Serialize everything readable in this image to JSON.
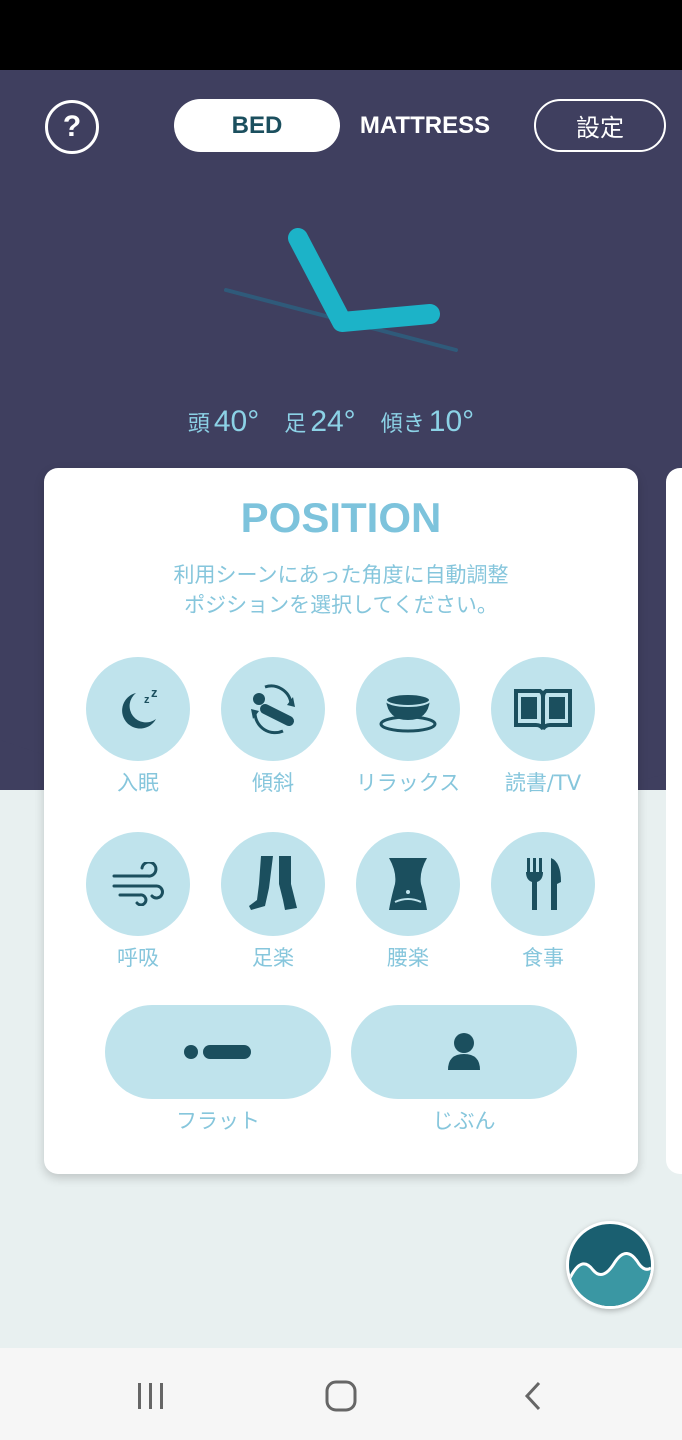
{
  "header": {
    "help_label": "?",
    "tabs": [
      {
        "label": "BED",
        "active": true
      },
      {
        "label": "MATTRESS",
        "active": false
      }
    ],
    "settings_label": "設定"
  },
  "angles": {
    "head_label": "頭",
    "head_value": "40°",
    "foot_label": "足",
    "foot_value": "24°",
    "tilt_label": "傾き",
    "tilt_value": "10°"
  },
  "card": {
    "title": "POSITION",
    "desc_line1": "利用シーンにあった角度に自動調整",
    "desc_line2": "ポジションを選択してください。",
    "positions": [
      {
        "label": "入眠",
        "icon": "sleep-moon-icon"
      },
      {
        "label": "傾斜",
        "icon": "tilt-rotate-icon"
      },
      {
        "label": "リラックス",
        "icon": "tea-cup-icon"
      },
      {
        "label": "読書/TV",
        "icon": "book-icon"
      },
      {
        "label": "呼吸",
        "icon": "wind-icon"
      },
      {
        "label": "足楽",
        "icon": "legs-icon"
      },
      {
        "label": "腰楽",
        "icon": "waist-icon"
      },
      {
        "label": "食事",
        "icon": "fork-knife-icon"
      }
    ],
    "pills": [
      {
        "label": "フラット",
        "icon": "flat-icon"
      },
      {
        "label": "じぶん",
        "icon": "person-icon"
      }
    ]
  },
  "colors": {
    "header_bg": "#3f3f5f",
    "accent": "#1cb3c8",
    "icon_circle": "#bfe3ec",
    "icon_fg": "#1b4f5e",
    "label_text": "#86c6dc"
  }
}
